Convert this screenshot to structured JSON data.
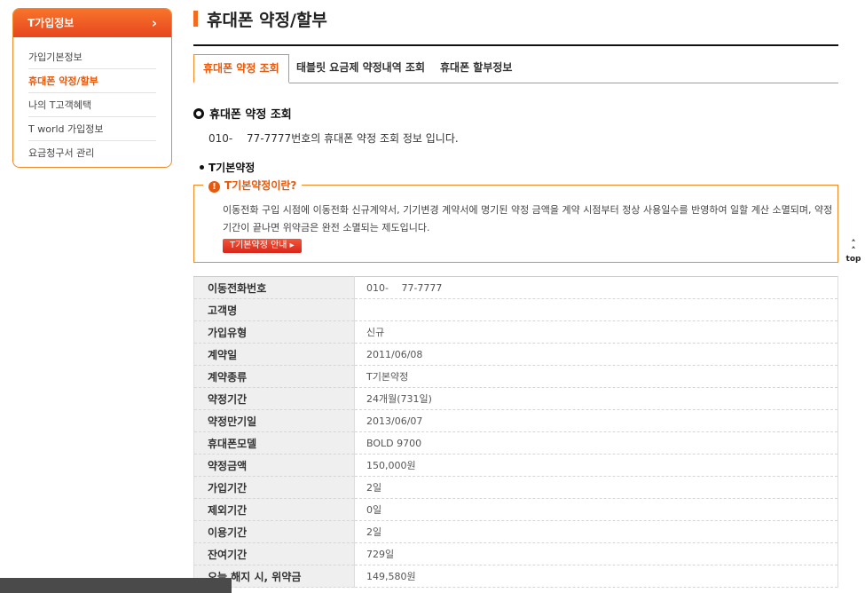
{
  "sidebar": {
    "header": "T가입정보",
    "items": [
      {
        "label": "가입기본정보"
      },
      {
        "label": "휴대폰 약정/할부"
      },
      {
        "label": "나의 T고객혜택"
      },
      {
        "label": "T world 가입정보"
      },
      {
        "label": "요금청구서 관리"
      }
    ]
  },
  "page": {
    "title": "휴대폰 약정/할부"
  },
  "tabs": [
    {
      "label": "휴대폰 약정 조회"
    },
    {
      "label": "태블릿 요금제 약정내역 조회"
    },
    {
      "label": "휴대폰 할부정보"
    }
  ],
  "section": {
    "title": "휴대폰 약정 조회",
    "description": "010-　 77-7777번호의 휴대폰 약정 조회 정보 입니다.",
    "subtitle": "T기본약정"
  },
  "info": {
    "question": "T기본약정이란?",
    "text": "이동전화 구입 시점에 이동전화 신규계약서, 기기변경 계약서에 명기된 약정 금액을 계약 시점부터 정상 사용일수를 반영하여 일할 계산 소멸되며, 약정기간이 끝나면 위약금은 완전 소멸되는 제도입니다.",
    "button": "T기본약정 안내 ▸"
  },
  "table": {
    "rows": [
      {
        "label": "이동전화번호",
        "value": "010-　 77-7777"
      },
      {
        "label": "고객명",
        "value": ""
      },
      {
        "label": "가입유형",
        "value": "신규"
      },
      {
        "label": "계약일",
        "value": "2011/06/08"
      },
      {
        "label": "계약종류",
        "value": "T기본약정"
      },
      {
        "label": "약정기간",
        "value": "24개월(731일)"
      },
      {
        "label": "약정만기일",
        "value": "2013/06/07"
      },
      {
        "label": "휴대폰모델",
        "value": "BOLD 9700"
      },
      {
        "label": "약정금액",
        "value": "150,000원"
      },
      {
        "label": "가입기간",
        "value": "2일"
      },
      {
        "label": "제외기간",
        "value": "0일"
      },
      {
        "label": "이용기간",
        "value": "2일"
      },
      {
        "label": "잔여기간",
        "value": "729일"
      },
      {
        "label": "오늘 해지 시, 위약금",
        "value": "149,580원"
      }
    ]
  },
  "top_button": {
    "label": "top",
    "icon": "double-chevron-up-icon"
  },
  "colors": {
    "accent": "#f26b1f",
    "accent_text": "#e8590c"
  }
}
